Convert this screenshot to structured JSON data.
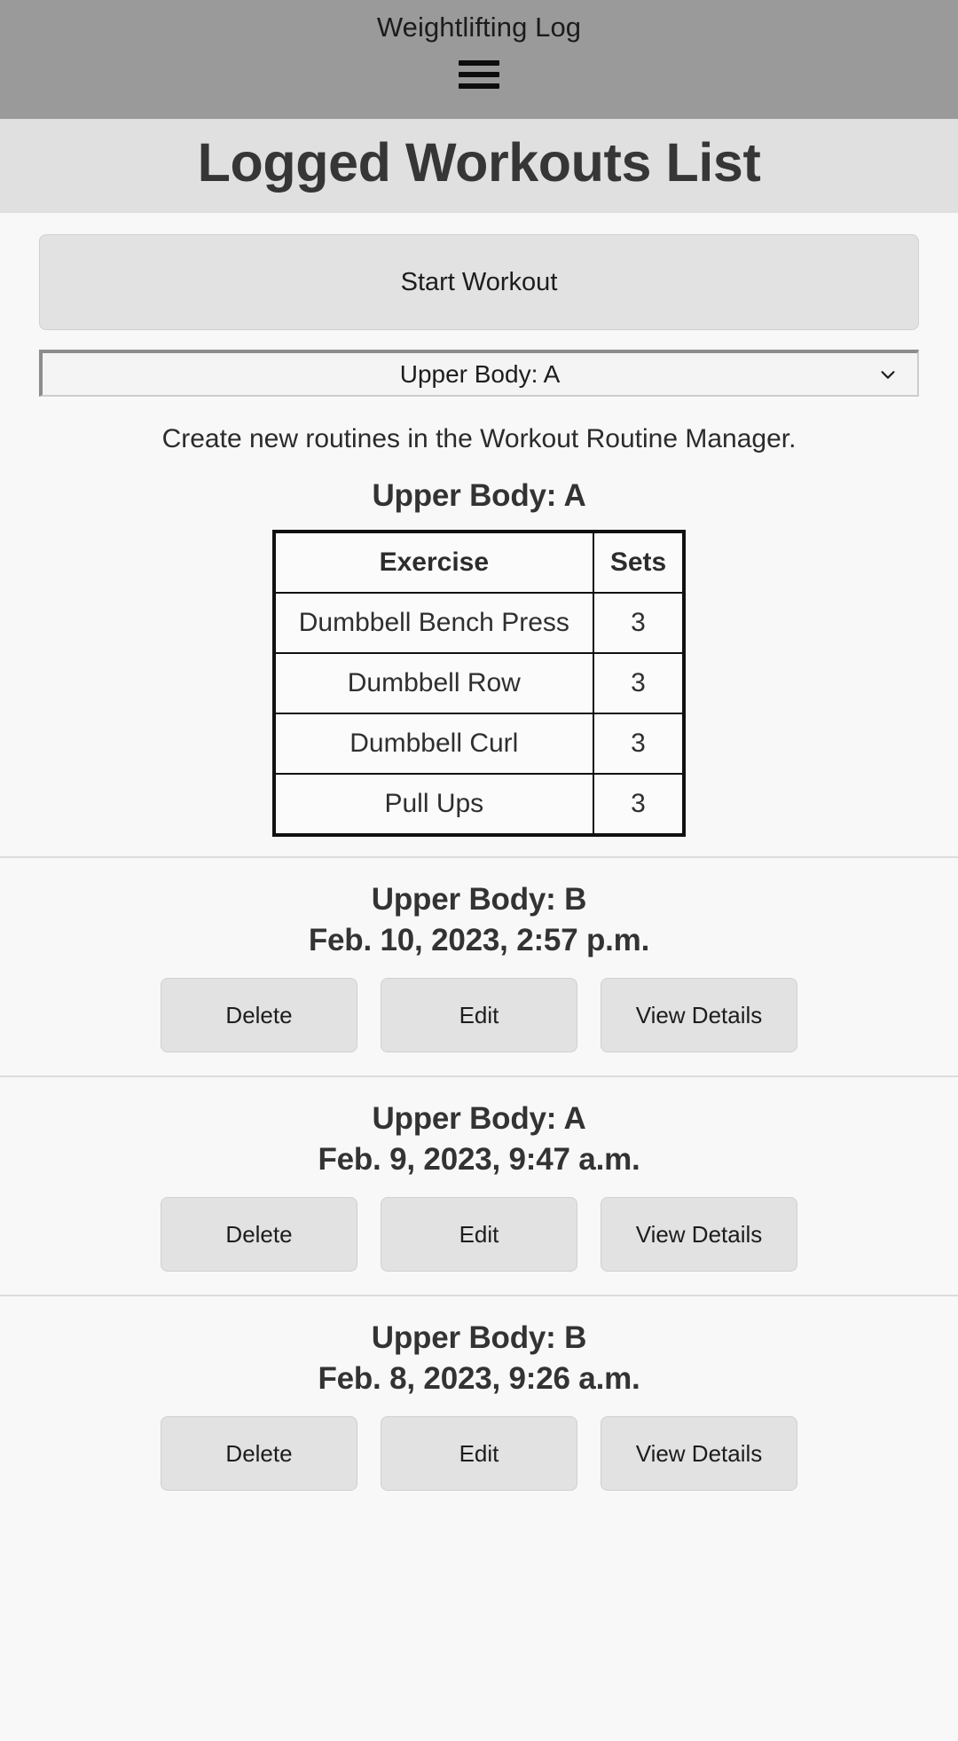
{
  "appbar": {
    "title": "Weightlifting Log",
    "menu_icon": "hamburger-menu-icon"
  },
  "page": {
    "title": "Logged Workouts List"
  },
  "actions": {
    "start_workout_label": "Start Workout"
  },
  "routine_select": {
    "selected": "Upper Body: A",
    "chevron_icon": "chevron-down-icon",
    "options": [
      "Upper Body: A"
    ]
  },
  "helper_text": "Create new routines in the Workout Routine Manager.",
  "routine_preview": {
    "name": "Upper Body: A",
    "columns": [
      "Exercise",
      "Sets"
    ],
    "rows": [
      {
        "exercise": "Dumbbell Bench Press",
        "sets": "3"
      },
      {
        "exercise": "Dumbbell Row",
        "sets": "3"
      },
      {
        "exercise": "Dumbbell Curl",
        "sets": "3"
      },
      {
        "exercise": "Pull Ups",
        "sets": "3"
      }
    ]
  },
  "log_entries": [
    {
      "routine": "Upper Body: B",
      "date": "Feb. 10, 2023, 2:57 p.m.",
      "delete_label": "Delete",
      "edit_label": "Edit",
      "details_label": "View Details"
    },
    {
      "routine": "Upper Body: A",
      "date": "Feb. 9, 2023, 9:47 a.m.",
      "delete_label": "Delete",
      "edit_label": "Edit",
      "details_label": "View Details"
    },
    {
      "routine": "Upper Body: B",
      "date": "Feb. 8, 2023, 9:26 a.m.",
      "delete_label": "Delete",
      "edit_label": "Edit",
      "details_label": "View Details"
    }
  ],
  "colors": {
    "appbar_bg": "#9a9a9a",
    "heading_band_bg": "#e0e0e0",
    "page_bg": "#f8f8f8",
    "button_bg": "#e2e2e2",
    "table_border": "#111111"
  }
}
